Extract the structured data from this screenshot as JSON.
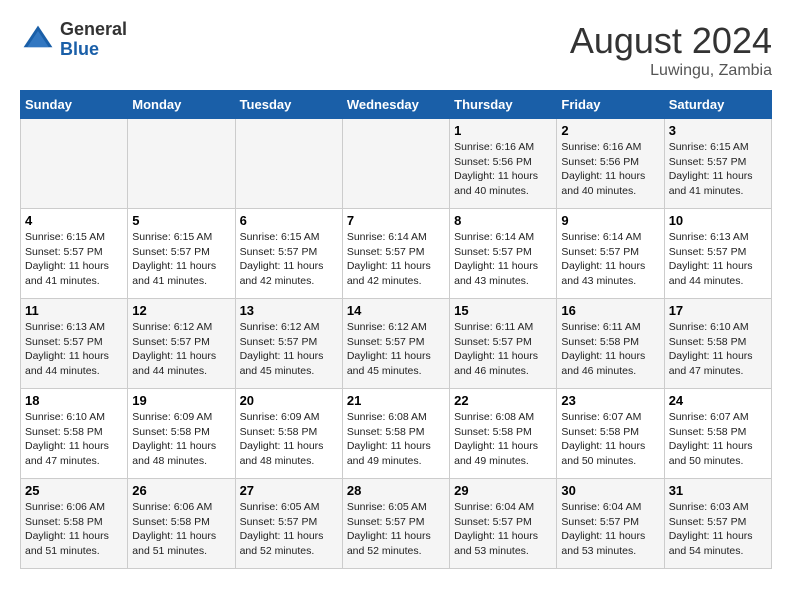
{
  "header": {
    "logo_general": "General",
    "logo_blue": "Blue",
    "month_year": "August 2024",
    "location": "Luwingu, Zambia"
  },
  "weekdays": [
    "Sunday",
    "Monday",
    "Tuesday",
    "Wednesday",
    "Thursday",
    "Friday",
    "Saturday"
  ],
  "weeks": [
    [
      {
        "day": "",
        "info": ""
      },
      {
        "day": "",
        "info": ""
      },
      {
        "day": "",
        "info": ""
      },
      {
        "day": "",
        "info": ""
      },
      {
        "day": "1",
        "info": "Sunrise: 6:16 AM\nSunset: 5:56 PM\nDaylight: 11 hours\nand 40 minutes."
      },
      {
        "day": "2",
        "info": "Sunrise: 6:16 AM\nSunset: 5:56 PM\nDaylight: 11 hours\nand 40 minutes."
      },
      {
        "day": "3",
        "info": "Sunrise: 6:15 AM\nSunset: 5:57 PM\nDaylight: 11 hours\nand 41 minutes."
      }
    ],
    [
      {
        "day": "4",
        "info": "Sunrise: 6:15 AM\nSunset: 5:57 PM\nDaylight: 11 hours\nand 41 minutes."
      },
      {
        "day": "5",
        "info": "Sunrise: 6:15 AM\nSunset: 5:57 PM\nDaylight: 11 hours\nand 41 minutes."
      },
      {
        "day": "6",
        "info": "Sunrise: 6:15 AM\nSunset: 5:57 PM\nDaylight: 11 hours\nand 42 minutes."
      },
      {
        "day": "7",
        "info": "Sunrise: 6:14 AM\nSunset: 5:57 PM\nDaylight: 11 hours\nand 42 minutes."
      },
      {
        "day": "8",
        "info": "Sunrise: 6:14 AM\nSunset: 5:57 PM\nDaylight: 11 hours\nand 43 minutes."
      },
      {
        "day": "9",
        "info": "Sunrise: 6:14 AM\nSunset: 5:57 PM\nDaylight: 11 hours\nand 43 minutes."
      },
      {
        "day": "10",
        "info": "Sunrise: 6:13 AM\nSunset: 5:57 PM\nDaylight: 11 hours\nand 44 minutes."
      }
    ],
    [
      {
        "day": "11",
        "info": "Sunrise: 6:13 AM\nSunset: 5:57 PM\nDaylight: 11 hours\nand 44 minutes."
      },
      {
        "day": "12",
        "info": "Sunrise: 6:12 AM\nSunset: 5:57 PM\nDaylight: 11 hours\nand 44 minutes."
      },
      {
        "day": "13",
        "info": "Sunrise: 6:12 AM\nSunset: 5:57 PM\nDaylight: 11 hours\nand 45 minutes."
      },
      {
        "day": "14",
        "info": "Sunrise: 6:12 AM\nSunset: 5:57 PM\nDaylight: 11 hours\nand 45 minutes."
      },
      {
        "day": "15",
        "info": "Sunrise: 6:11 AM\nSunset: 5:57 PM\nDaylight: 11 hours\nand 46 minutes."
      },
      {
        "day": "16",
        "info": "Sunrise: 6:11 AM\nSunset: 5:58 PM\nDaylight: 11 hours\nand 46 minutes."
      },
      {
        "day": "17",
        "info": "Sunrise: 6:10 AM\nSunset: 5:58 PM\nDaylight: 11 hours\nand 47 minutes."
      }
    ],
    [
      {
        "day": "18",
        "info": "Sunrise: 6:10 AM\nSunset: 5:58 PM\nDaylight: 11 hours\nand 47 minutes."
      },
      {
        "day": "19",
        "info": "Sunrise: 6:09 AM\nSunset: 5:58 PM\nDaylight: 11 hours\nand 48 minutes."
      },
      {
        "day": "20",
        "info": "Sunrise: 6:09 AM\nSunset: 5:58 PM\nDaylight: 11 hours\nand 48 minutes."
      },
      {
        "day": "21",
        "info": "Sunrise: 6:08 AM\nSunset: 5:58 PM\nDaylight: 11 hours\nand 49 minutes."
      },
      {
        "day": "22",
        "info": "Sunrise: 6:08 AM\nSunset: 5:58 PM\nDaylight: 11 hours\nand 49 minutes."
      },
      {
        "day": "23",
        "info": "Sunrise: 6:07 AM\nSunset: 5:58 PM\nDaylight: 11 hours\nand 50 minutes."
      },
      {
        "day": "24",
        "info": "Sunrise: 6:07 AM\nSunset: 5:58 PM\nDaylight: 11 hours\nand 50 minutes."
      }
    ],
    [
      {
        "day": "25",
        "info": "Sunrise: 6:06 AM\nSunset: 5:58 PM\nDaylight: 11 hours\nand 51 minutes."
      },
      {
        "day": "26",
        "info": "Sunrise: 6:06 AM\nSunset: 5:58 PM\nDaylight: 11 hours\nand 51 minutes."
      },
      {
        "day": "27",
        "info": "Sunrise: 6:05 AM\nSunset: 5:57 PM\nDaylight: 11 hours\nand 52 minutes."
      },
      {
        "day": "28",
        "info": "Sunrise: 6:05 AM\nSunset: 5:57 PM\nDaylight: 11 hours\nand 52 minutes."
      },
      {
        "day": "29",
        "info": "Sunrise: 6:04 AM\nSunset: 5:57 PM\nDaylight: 11 hours\nand 53 minutes."
      },
      {
        "day": "30",
        "info": "Sunrise: 6:04 AM\nSunset: 5:57 PM\nDaylight: 11 hours\nand 53 minutes."
      },
      {
        "day": "31",
        "info": "Sunrise: 6:03 AM\nSunset: 5:57 PM\nDaylight: 11 hours\nand 54 minutes."
      }
    ]
  ]
}
